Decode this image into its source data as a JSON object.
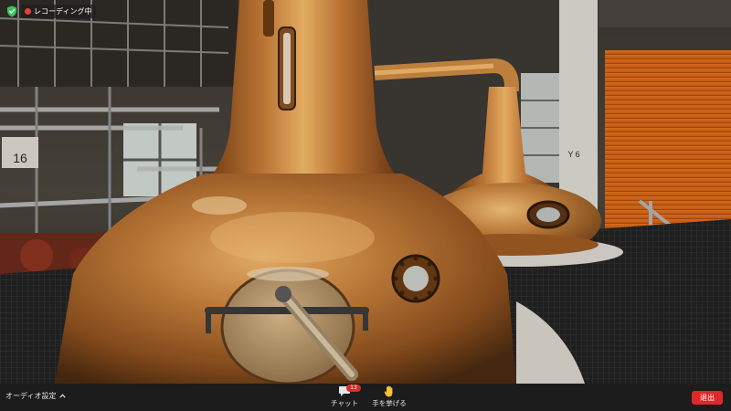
{
  "status": {
    "recording_label": "レコーディング中",
    "shield_color": "#38c45c",
    "rec_color": "#e0413b"
  },
  "video": {
    "wall_sign_left": "16",
    "wall_sign_right": "Y 6"
  },
  "toolbar": {
    "audio_settings_label": "オーディオ設定",
    "chat_label": "チャット",
    "chat_badge": "13",
    "raise_hand_label": "手を挙げる",
    "leave_label": "退出",
    "leave_color": "#e02828"
  }
}
